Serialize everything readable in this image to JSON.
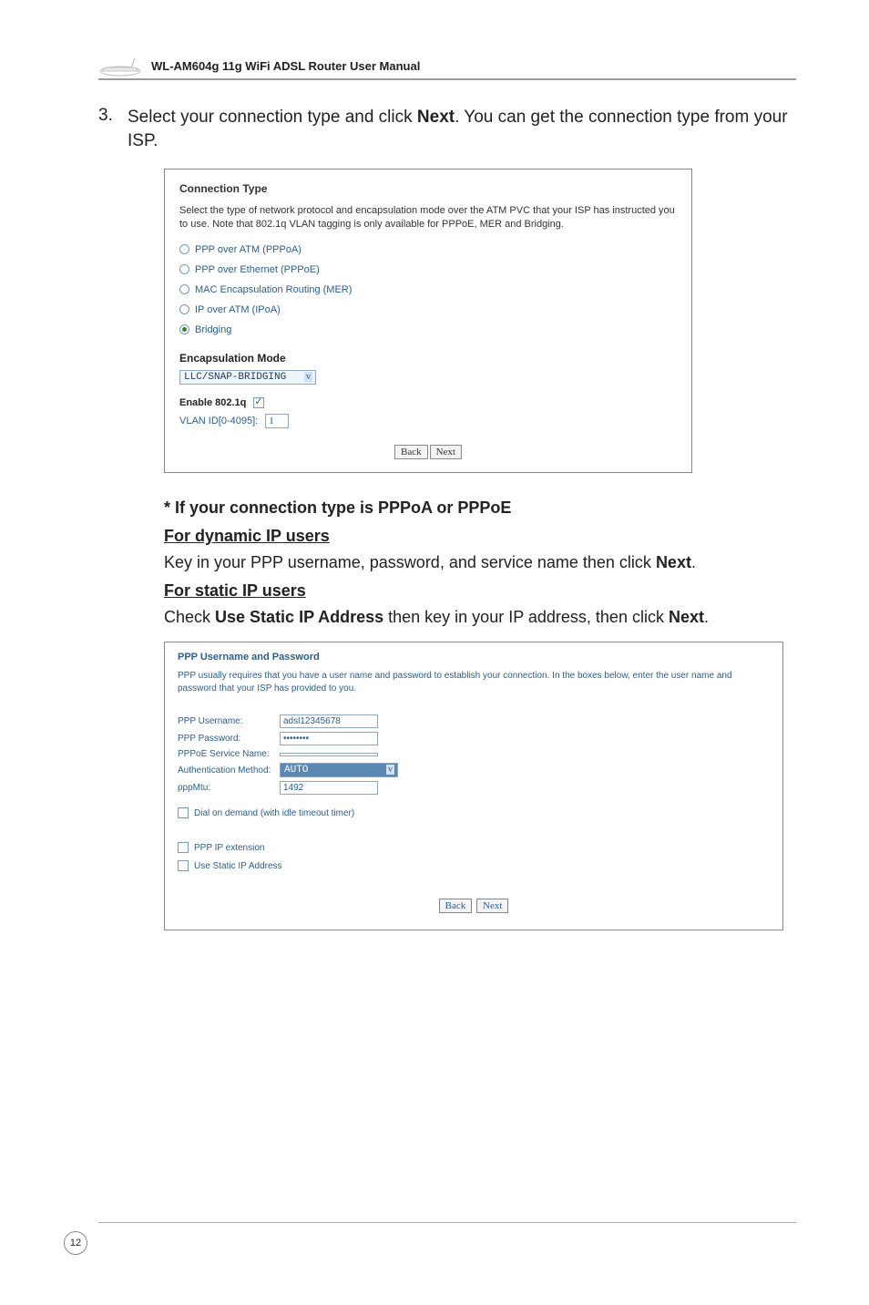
{
  "header": {
    "title": "WL-AM604g 11g WiFi ADSL Router User Manual"
  },
  "step": {
    "number": "3.",
    "text_before_bold": "Select your connection type and click ",
    "bold_word": "Next",
    "text_after_bold": ". You can get the connection type from your ISP."
  },
  "panel1": {
    "heading": "Connection Type",
    "description": "Select the type of network protocol and encapsulation mode over the ATM PVC that your ISP has instructed you to use. Note that 802.1q VLAN tagging is only available for PPPoE, MER and Bridging.",
    "options": [
      {
        "label": "PPP over ATM (PPPoA)",
        "selected": false
      },
      {
        "label": "PPP over Ethernet (PPPoE)",
        "selected": false
      },
      {
        "label": "MAC Encapsulation Routing (MER)",
        "selected": false
      },
      {
        "label": "IP over ATM (IPoA)",
        "selected": false
      },
      {
        "label": "Bridging",
        "selected": true
      }
    ],
    "encap_heading": "Encapsulation Mode",
    "encap_value": "LLC/SNAP-BRIDGING",
    "enable_label": "Enable 802.1q",
    "enable_checked": true,
    "vlan_label": "VLAN ID[0-4095]:",
    "vlan_value": "1",
    "buttons": {
      "back": "Back",
      "next": "Next"
    }
  },
  "conditional": {
    "asterisk_line": "* If your connection type is PPPoA or PPPoE",
    "dynamic_head": "For dynamic IP users",
    "dynamic_text_before": "Key in your PPP username, password, and service name then click ",
    "dynamic_bold": "Next",
    "dynamic_after": ".",
    "static_head": "For static IP users",
    "static_text_1": "Check ",
    "static_bold_1": "Use Static IP Address",
    "static_text_2": " then key in your IP address, then click ",
    "static_bold_2": "Next",
    "static_after": "."
  },
  "panel2": {
    "heading": "PPP Username and Password",
    "description": "PPP usually requires that you have a user name and password to establish your connection. In the boxes below, enter the user name and password that your ISP has provided to you.",
    "rows": {
      "username_label": "PPP Username:",
      "username_value": "adsl12345678",
      "password_label": "PPP Password:",
      "password_value": "••••••••",
      "service_label": "PPPoE Service Name:",
      "service_value": "",
      "auth_label": "Authentication Method:",
      "auth_value": "AUTO",
      "mtu_label": "pppMtu:",
      "mtu_value": "1492"
    },
    "checks": {
      "dial_label": "Dial on demand (with idle timeout timer)",
      "ppp_ip_label": "PPP IP extension",
      "static_ip_label": "Use Static IP Address"
    },
    "buttons": {
      "back": "Back",
      "next": "Next"
    }
  },
  "page_number": "12"
}
